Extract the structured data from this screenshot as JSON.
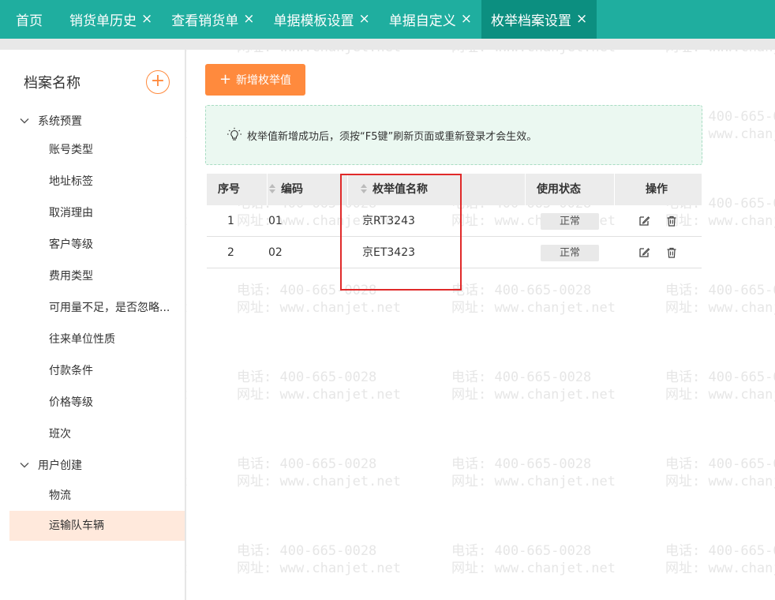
{
  "tabs": [
    {
      "label": "首页",
      "closable": false,
      "active": false
    },
    {
      "label": "销货单历史",
      "closable": true,
      "active": false
    },
    {
      "label": "查看销货单",
      "closable": true,
      "active": false
    },
    {
      "label": "单据模板设置",
      "closable": true,
      "active": false
    },
    {
      "label": "单据自定义",
      "closable": true,
      "active": false
    },
    {
      "label": "枚举档案设置",
      "closable": true,
      "active": true
    }
  ],
  "tab_close_glyph": "×",
  "sidebar": {
    "title": "档案名称",
    "add_glyph": "+",
    "groups": [
      {
        "label": "系统预置",
        "items": [
          "账号类型",
          "地址标签",
          "取消理由",
          "客户等级",
          "费用类型",
          "可用量不足，是否忽略...",
          "往来单位性质",
          "付款条件",
          "价格等级",
          "班次"
        ]
      },
      {
        "label": "用户创建",
        "items": [
          "物流",
          "运输队车辆"
        ]
      }
    ],
    "active_item": "运输队车辆"
  },
  "main": {
    "add_button": {
      "icon": "+",
      "label": "新增枚举值"
    },
    "notice": "枚举值新增成功后，须按“F5键”刷新页面或重新登录才会生效。",
    "table": {
      "headers": {
        "index": "序号",
        "code": "编码",
        "name": "枚举值名称",
        "status": "使用状态",
        "actions": "操作"
      },
      "rows": [
        {
          "index": "1",
          "code": "01",
          "name": "京RT3243",
          "status": "正常"
        },
        {
          "index": "2",
          "code": "02",
          "name": "京ET3423",
          "status": "正常"
        }
      ]
    }
  },
  "watermark": {
    "phone": "电话: 400-665-0028",
    "site": "网址: www.chanjet.net"
  },
  "colors": {
    "topbar": "#1fae9f",
    "active_tab": "#0c8f80",
    "accent": "#ff8a3d",
    "notice_bg": "#ebf8f1",
    "highlight": "#e02a2a",
    "active_item_bg": "#ffe9dc"
  }
}
